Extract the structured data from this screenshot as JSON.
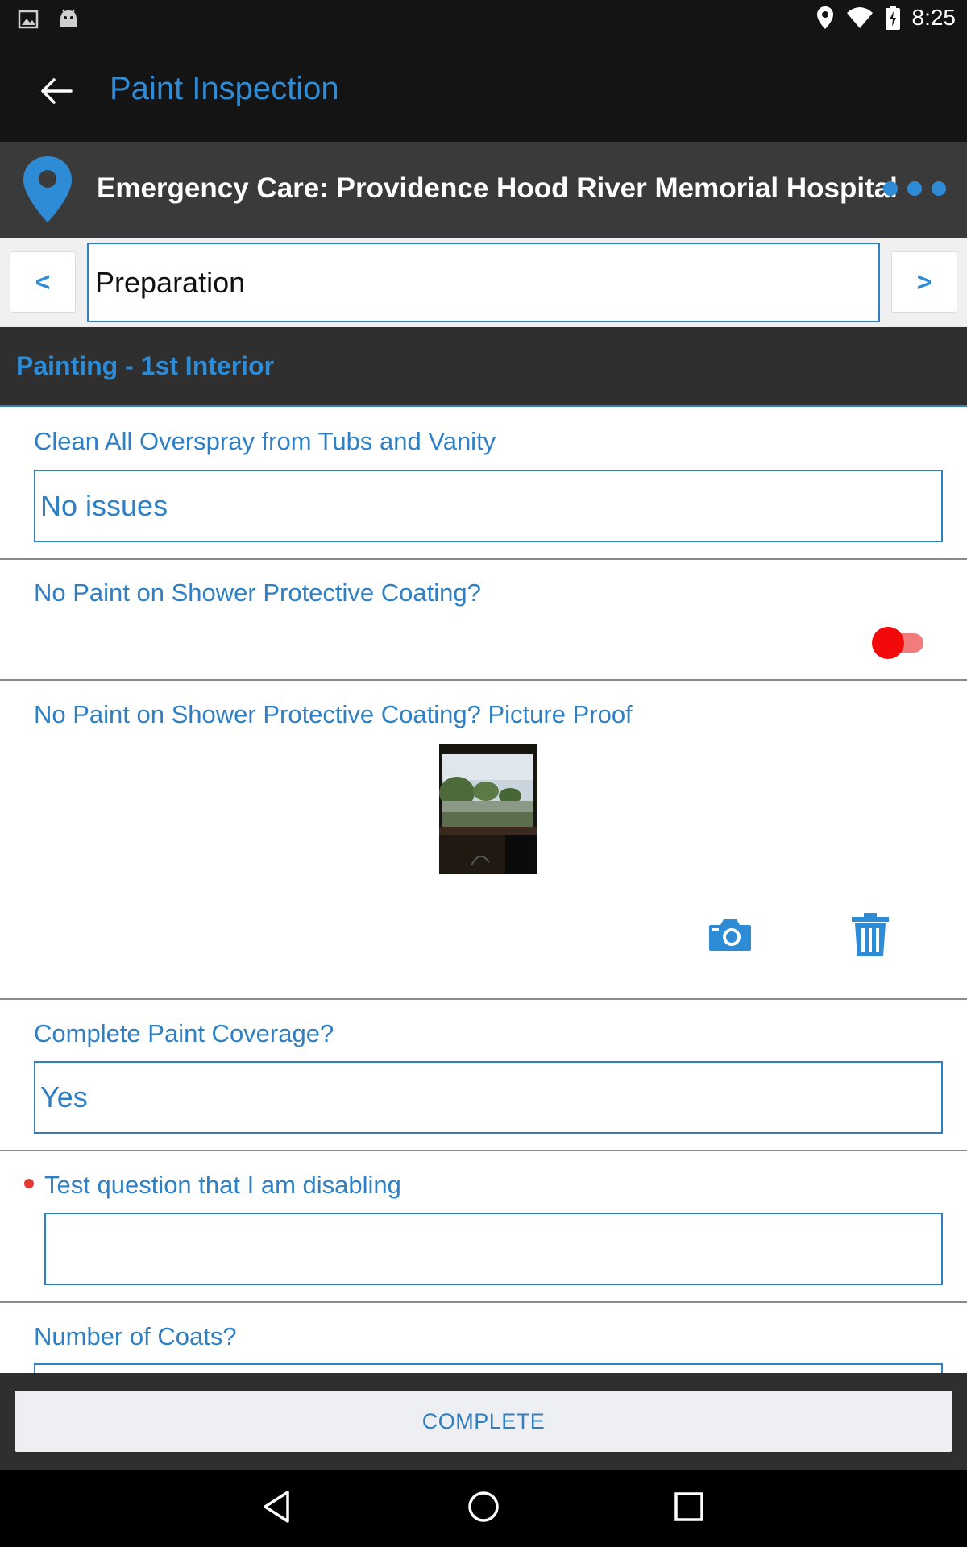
{
  "status_bar": {
    "time": "8:25",
    "icons": [
      "image-icon",
      "android-icon",
      "location-icon",
      "wifi-icon",
      "battery-icon"
    ]
  },
  "app_bar": {
    "title": "Paint Inspection",
    "back_icon": "arrow-back-icon"
  },
  "location": {
    "name": "Emergency Care: Providence Hood River Memorial Hospital",
    "pin_icon": "map-pin-icon",
    "more_icon": "more-dots-icon"
  },
  "section_nav": {
    "prev_label": "<",
    "current": "Preparation",
    "next_label": ">"
  },
  "group": {
    "title": "Painting - 1st Interior"
  },
  "questions": [
    {
      "label": "Clean All Overspray from Tubs and Vanity",
      "value": "No issues",
      "type": "text"
    },
    {
      "label": "No Paint on Shower Protective Coating?",
      "value": false,
      "type": "toggle"
    },
    {
      "label": "No Paint on Shower Protective Coating? Picture Proof",
      "type": "photo",
      "actions": [
        "camera-icon",
        "trash-icon"
      ]
    },
    {
      "label": "Complete Paint Coverage?",
      "value": "Yes",
      "type": "text"
    },
    {
      "label": "Test question that I am disabling",
      "value": "",
      "type": "text",
      "required": true
    },
    {
      "label": "Number of Coats?",
      "value": "",
      "type": "text"
    }
  ],
  "footer": {
    "complete_label": "COMPLETE"
  },
  "system_nav": [
    "back-triangle-icon",
    "home-circle-icon",
    "recents-square-icon"
  ],
  "colors": {
    "accent": "#2e8bd6",
    "dark_bar": "#141414",
    "header_bar": "#2f2f2f",
    "toggle_off": "#f20a0a",
    "required": "#e53935"
  }
}
